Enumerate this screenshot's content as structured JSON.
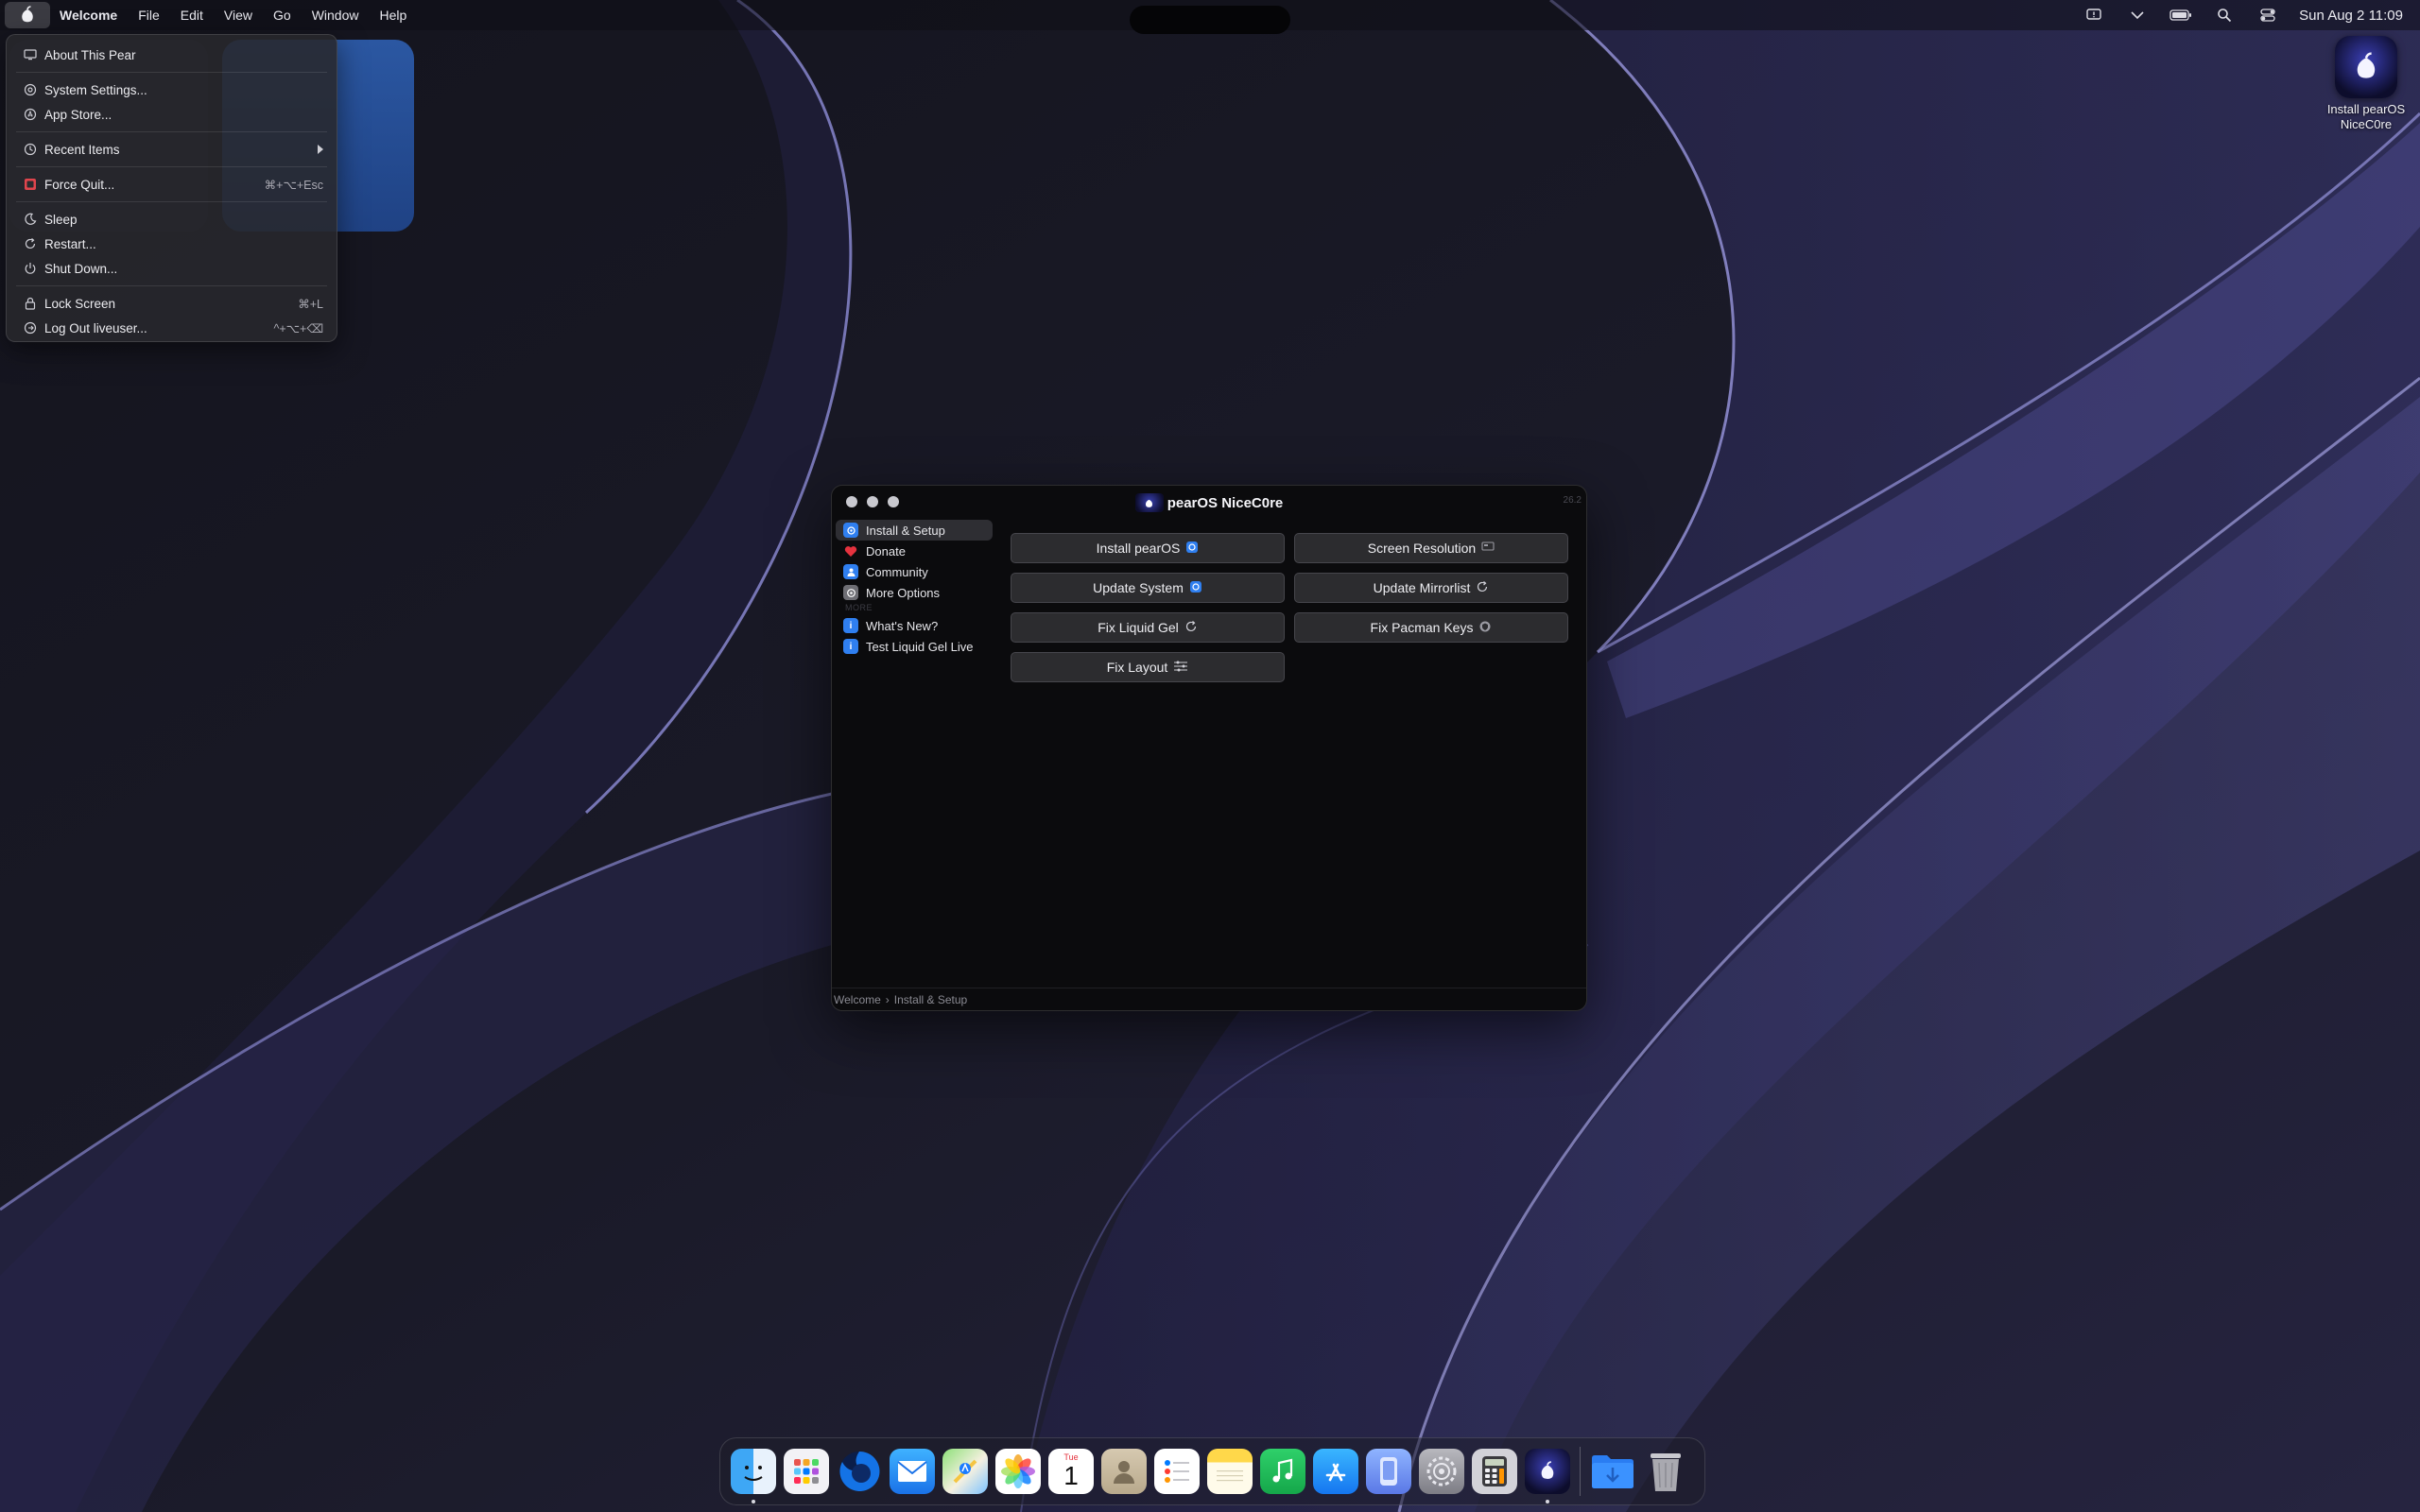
{
  "menubar": {
    "app_name": "Welcome",
    "menus": [
      "File",
      "Edit",
      "View",
      "Go",
      "Window",
      "Help"
    ],
    "status_icons": [
      "feedback-icon",
      "chevron-down-icon",
      "battery-icon",
      "search-icon",
      "control-center-icon"
    ],
    "clock": "Sun Aug 2  11:09"
  },
  "apple_menu": {
    "items": [
      {
        "label": "About This Pear",
        "icon": "monitor-icon",
        "shortcut": ""
      },
      {
        "label": "System Settings...",
        "icon": "gear-icon",
        "shortcut": ""
      },
      {
        "label": "App Store...",
        "icon": "app-store-icon",
        "shortcut": ""
      },
      {
        "label": "Recent Items",
        "icon": "clock-icon",
        "shortcut": ""
      },
      {
        "label": "Force Quit...",
        "icon": "force-quit-icon",
        "shortcut": "⌘+⌥+Esc"
      },
      {
        "label": "Sleep",
        "icon": "moon-icon",
        "shortcut": ""
      },
      {
        "label": "Restart...",
        "icon": "restart-icon",
        "shortcut": ""
      },
      {
        "label": "Shut Down...",
        "icon": "power-icon",
        "shortcut": ""
      },
      {
        "label": "Lock Screen",
        "icon": "lock-icon",
        "shortcut": "⌘+L"
      },
      {
        "label": "Log Out liveuser...",
        "icon": "logout-icon",
        "shortcut": "^+⌥+⌫"
      }
    ]
  },
  "desktop": {
    "icon_label": "Install pearOS NiceC0re"
  },
  "welcome_window": {
    "title": "pearOS NiceC0re",
    "version": "26.2",
    "sidebar": {
      "items": [
        {
          "label": "Install & Setup",
          "icon": "install-icon",
          "color": "#2f7ff0"
        },
        {
          "label": "Donate",
          "icon": "heart-icon",
          "color": "#e5323e"
        },
        {
          "label": "Community",
          "icon": "community-icon",
          "color": "#2f7ff0"
        },
        {
          "label": "More Options",
          "icon": "options-icon",
          "color": "#8a8a90"
        }
      ],
      "section_label": "MORE",
      "more_items": [
        {
          "label": "What's New?",
          "icon": "info-icon",
          "color": "#2f7ff0"
        },
        {
          "label": "Test Liquid Gel Live",
          "icon": "info-icon",
          "color": "#2f7ff0"
        }
      ]
    },
    "buttons": [
      {
        "label": "Install pearOS",
        "icon": "installer-icon"
      },
      {
        "label": "Screen Resolution",
        "icon": "display-icon"
      },
      {
        "label": "Update System",
        "icon": "installer-icon"
      },
      {
        "label": "Update Mirrorlist",
        "icon": "refresh-icon"
      },
      {
        "label": "Fix Liquid Gel",
        "icon": "refresh-icon"
      },
      {
        "label": "Fix Pacman Keys",
        "icon": "shield-icon"
      },
      {
        "label": "Fix Layout",
        "icon": "sliders-icon"
      }
    ],
    "breadcrumb": [
      "Welcome",
      "Install & Setup"
    ]
  },
  "dock": {
    "apps": [
      {
        "name": "finder-icon",
        "running": true
      },
      {
        "name": "launchpad-icon",
        "running": false
      },
      {
        "name": "firefox-icon",
        "running": false
      },
      {
        "name": "mail-icon",
        "running": false
      },
      {
        "name": "maps-icon",
        "running": false
      },
      {
        "name": "photos-icon",
        "running": false
      },
      {
        "name": "calendar-icon",
        "running": false
      },
      {
        "name": "contacts-icon",
        "running": false
      },
      {
        "name": "reminders-icon",
        "running": false
      },
      {
        "name": "notes-icon",
        "running": false
      },
      {
        "name": "music-icon",
        "running": false
      },
      {
        "name": "app-store-icon",
        "running": false
      },
      {
        "name": "system-info-icon",
        "running": false
      },
      {
        "name": "system-settings-icon",
        "running": false
      },
      {
        "name": "calculator-icon",
        "running": false
      },
      {
        "name": "welcome-icon",
        "running": true
      }
    ],
    "calendar_day": "Tue",
    "calendar_date": "1",
    "extras": [
      "downloads-folder-icon",
      "trash-icon"
    ]
  }
}
